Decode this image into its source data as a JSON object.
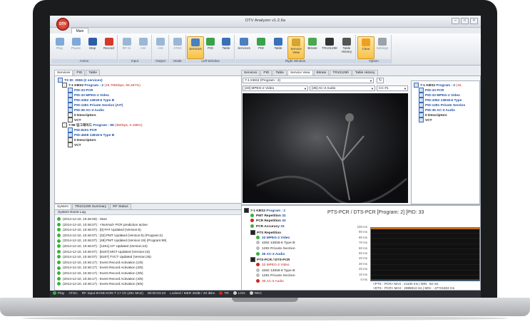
{
  "app": {
    "title": "DTV Analyzer v1.2.6a",
    "logo_text": "DTV",
    "main_tab": "Main"
  },
  "ribbon": {
    "groups": [
      {
        "label": "Action",
        "buttons": [
          "Play",
          "Pause",
          "Stop",
          "Record"
        ]
      },
      {
        "label": "Input",
        "buttons": [
          "RF-In",
          "ASI"
        ]
      },
      {
        "label": "Output",
        "buttons": [
          "ASI"
        ]
      },
      {
        "label": "Mode",
        "buttons": [
          "ATSC"
        ]
      },
      {
        "label": "Left Window",
        "buttons": [
          "Services",
          "PID",
          "Table"
        ]
      },
      {
        "label": "Right Window",
        "buttons": [
          "Services",
          "PID",
          "Table",
          "Service View",
          "Bitrate",
          "TR101290",
          "Table History"
        ]
      },
      {
        "label": "Option",
        "buttons": [
          "Clear",
          "Settings"
        ]
      }
    ]
  },
  "left_top": {
    "tabs": [
      "Services",
      "PID",
      "Table"
    ],
    "tree": [
      {
        "text": "TS ID: 2065 (2 services)",
        "style": "blue"
      },
      {
        "text": "7-1 KBS2",
        "extra": "Program : 2",
        "rate": "(18,708Kbps, 96.467%)"
      },
      {
        "text": "PID:33 PCR",
        "style": "blue"
      },
      {
        "text": "PID:33 MPEG-2 Video",
        "style": "blue"
      },
      {
        "text": "PID:4352 13818-6 Type B",
        "style": "blue"
      },
      {
        "text": "PID:1281 Private Section (AIT)",
        "style": "blue"
      },
      {
        "text": "PID:36 AC-3 Audio",
        "style": "blue"
      },
      {
        "text": "0 Descriptors"
      },
      {
        "text": "VCT"
      },
      {
        "text": "7-99 업그레이드",
        "extra": "Program : 99",
        "rate": "(36Kbps, 0.186%)"
      },
      {
        "text": "PID:8191 PCR",
        "style": "blue"
      },
      {
        "text": "PID:4608 13818-6 Type B",
        "style": "blue"
      },
      {
        "text": "0 Descriptors"
      },
      {
        "text": "VCT"
      }
    ]
  },
  "left_bottom": {
    "tabs": [
      "System",
      "TR101290 Summary",
      "RF Status"
    ],
    "header": "System Event Log",
    "log": [
      "(2014-12-10, 10:46:06) : Start",
      "(2014-12-10, 10:46:07) : <Normal> PCR prediction active",
      "(2014-12-10, 10:46:07) : [0] PAT Updated (Version:5)",
      "(2014-12-10, 10:46:07) : [32] PMT Updated (Version:5) (Program:2)",
      "(2014-12-10, 10:46:07) : [48] PMT Updated (Version:19) (Program:99)",
      "(2014-12-10, 10:46:07) : [1281] AIT Updated (Version:22)",
      "(2014-12-10, 10:46:07) : [8187] MGT Updated (Version:15)",
      "(2014-12-10, 10:46:07) : [8187] TVCT Updated (Version:26)",
      "(2014-12-10, 10:46:17) : Event Record Activation (1/5)",
      "(2014-12-10, 10:46:17) : Event Record Activation (2/5)",
      "(2014-12-10, 10:46:17) : Event Record Activation (3/5)",
      "(2014-12-10, 10:46:17) : Event Record Activation (4/5)",
      "(2014-12-10, 10:46:17) : Event Record Activation (5/5)"
    ]
  },
  "right_top": {
    "tabs": [
      "Services",
      "PID",
      "Table",
      "Service View",
      "Bitrate",
      "TR101290",
      "Table History"
    ],
    "service_combo": "7-1 KBS2 (Program : 2)",
    "video_combo": "[33] MPEG-2 Video",
    "audio_combo": "[36] AC-3 Audio",
    "cc_combo": "CC #1",
    "tree": [
      {
        "text": "7-1 KBS2",
        "extra": "Program : 2",
        "rate": "(18,"
      },
      {
        "text": "PID:33 PCR"
      },
      {
        "text": "PID:33 MPEG-2 Video"
      },
      {
        "text": "PID:4352 13818-6 Type"
      },
      {
        "text": "PID:1281 Private Section"
      },
      {
        "text": "PID:36 AC-3 Audio"
      },
      {
        "text": "0 Descriptors"
      },
      {
        "text": "VCT"
      }
    ]
  },
  "right_bottom": {
    "tree": [
      {
        "text": "7-1 KBS2",
        "extra": "Program : 2",
        "dot": "none"
      },
      {
        "text": "PMT Repetition",
        "value": "32",
        "dot": "green"
      },
      {
        "text": "PCR Repetition",
        "value": "33",
        "dot": "red"
      },
      {
        "text": "PCR Accuracy",
        "value": "33",
        "dot": "green"
      },
      {
        "text": "PTS Repetition",
        "dot": "none"
      },
      {
        "text": "33 MPEG-2 Video",
        "dot": "green"
      },
      {
        "text": "4352 13818-6 Type B",
        "dot": "gray"
      },
      {
        "text": "1281 Private Section",
        "dot": "gray"
      },
      {
        "text": "36 AC-3 Audio",
        "dot": "green"
      },
      {
        "text": "PTS-PCR / DTS-PCR",
        "dot": "none"
      },
      {
        "text": "33 MPEG-2 Video",
        "dot": "red"
      },
      {
        "text": "4352 13818-6 Type B",
        "dot": "gray"
      },
      {
        "text": "1281 Private Section",
        "dot": "gray"
      },
      {
        "text": "36 AC-3 Audio",
        "dot": "red"
      }
    ],
    "chart_title": "PTS-PCR / DTS-PCR [Program: 2] [PID: 33",
    "y_ticks": [
      "100 ms",
      "90 ms",
      "80 ms",
      "70 ms",
      "60 ms",
      "50 ms",
      "40 ms",
      "30 ms",
      "20 ms",
      "10 ms",
      "0 ms"
    ],
    "legend": [
      "<PTS - PCR> MAX : 21100 ms | MIN : 82 ms",
      "<DTS - PCR> MAX : 2985913 ms | MIN : -47721602 ms"
    ]
  },
  "chart_data": {
    "type": "line",
    "title": "PTS-PCR / DTS-PCR [Program: 2] [PID: 33",
    "ylabel": "",
    "ylim": [
      0,
      100
    ],
    "y_unit": "ms",
    "series": [
      {
        "name": "<PTS - PCR>",
        "values": [
          100,
          100,
          100,
          100,
          100,
          100,
          100,
          100,
          100,
          100,
          100,
          100
        ]
      },
      {
        "name": "<DTS - PCR>",
        "values": [
          0,
          0,
          0,
          0,
          0,
          0,
          0,
          0,
          0,
          0,
          0,
          0
        ]
      }
    ]
  },
  "status": {
    "play": "Play",
    "mode": "ATSC",
    "input": "RF Input 8VSB KOR-T 17 Ch (491 MHz)",
    "time": "00:00:03:43",
    "lock": "Locked / MER 26dB / 40 dBm",
    "tr": "TR",
    "log": "LOG",
    "rec": "REC"
  },
  "colors": {
    "accent_orange": "#f7c24a",
    "status_green": "#38b23a",
    "status_red": "#d2251c",
    "chart_line": "#ff8a1c"
  }
}
